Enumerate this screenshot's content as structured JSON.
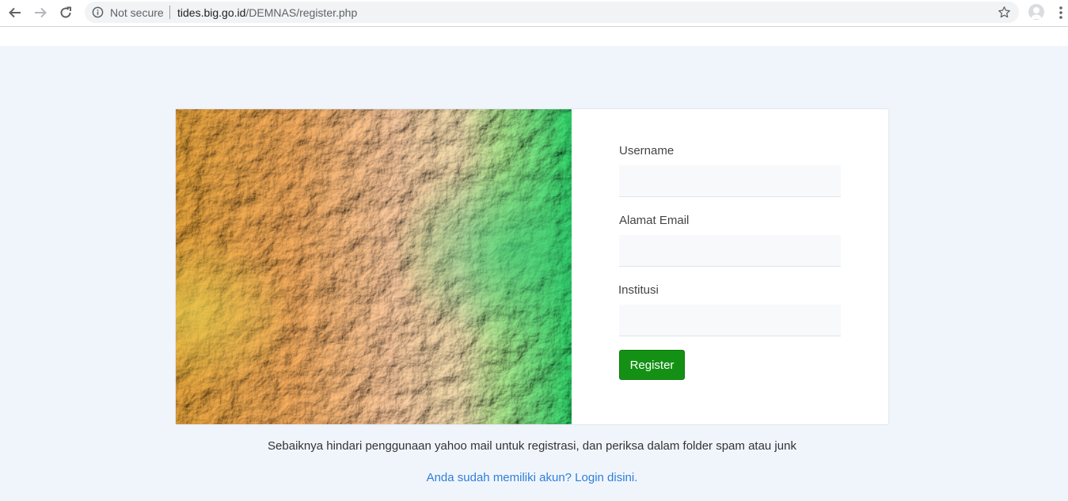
{
  "browser": {
    "security_label": "Not secure",
    "url_host": "tides.big.go.id",
    "url_path": "/DEMNAS/register.php"
  },
  "form": {
    "username_label": "Username",
    "username_value": "",
    "email_label": "Alamat Email",
    "email_value": "",
    "institution_label": "Institusi",
    "institution_value": "",
    "register_label": "Register"
  },
  "notice_text": "Sebaiknya hindari penggunaan yahoo mail untuk registrasi, dan periksa dalam folder spam atau junk",
  "login_link": "Anda sudah memiliki akun? Login disini.",
  "colors": {
    "page_bg": "#f0f5fc",
    "button": "#149114",
    "link": "#2f7fd8"
  }
}
